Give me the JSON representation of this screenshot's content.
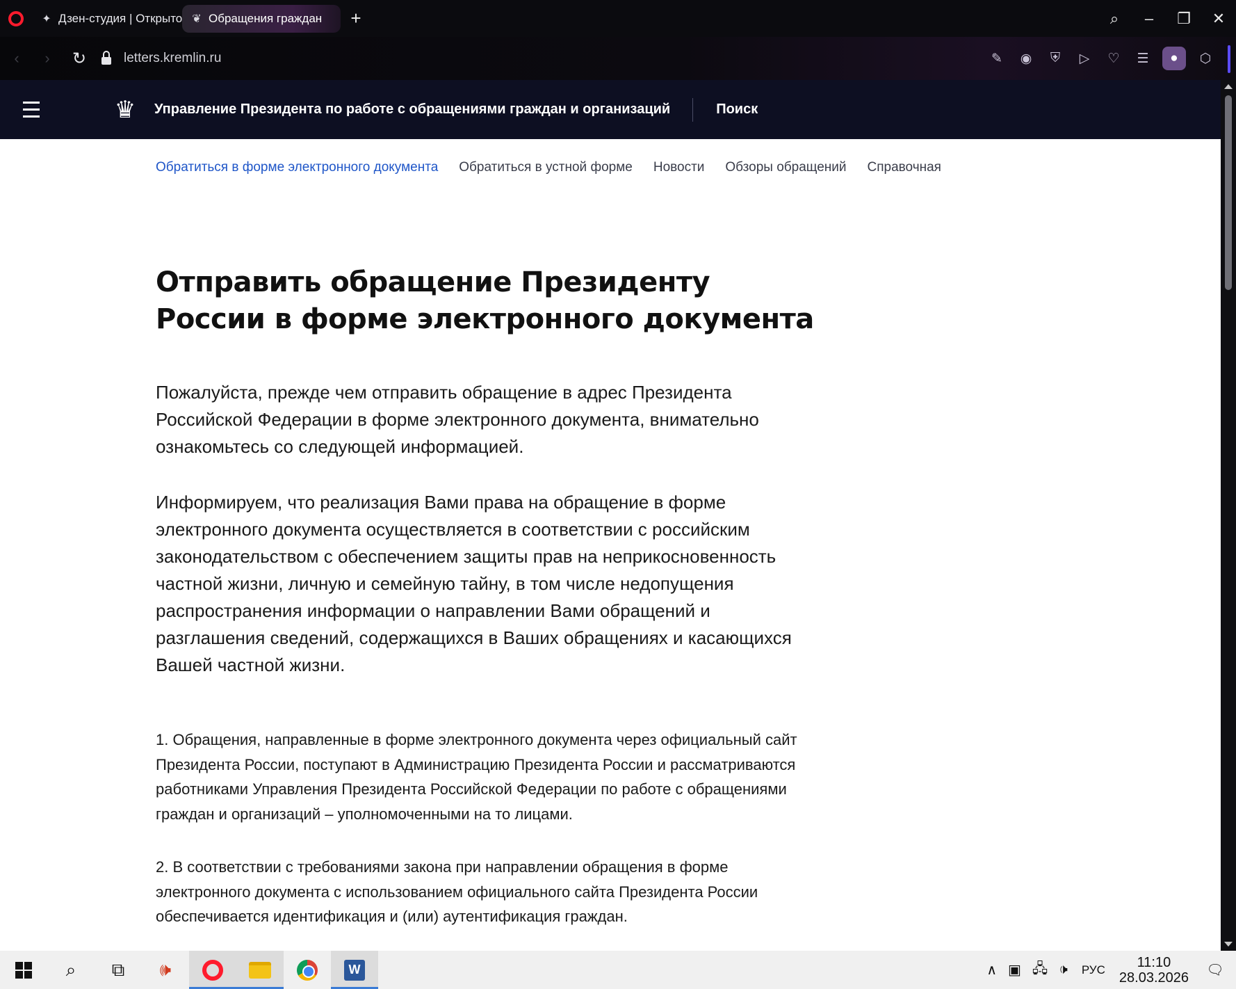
{
  "browser": {
    "tabs": [
      {
        "label": "Дзен-студия | Открытое",
        "active": false,
        "icon": "sparkle-icon"
      },
      {
        "label": "Обращения граждан",
        "active": true,
        "icon": "emblem-icon"
      }
    ],
    "new_tab": "+",
    "url": "letters.kremlin.ru"
  },
  "site": {
    "title": "Управление Президента по работе с обращениями граждан и организаций",
    "search": "Поиск",
    "subnav": [
      "Обратиться в форме электронного документа",
      "Обратиться в устной форме",
      "Новости",
      "Обзоры обращений",
      "Справочная"
    ],
    "accent_color": "#1f56c8",
    "header_color": "#0d0f22"
  },
  "page": {
    "title": "Отправить обращение Президенту России в форме электронного документа",
    "lead1": "Пожалуйста, прежде чем отправить обращение в адрес Президента Российской Федерации в форме электронного документа, внимательно ознакомьтесь со следующей информацией.",
    "lead2": "Информируем, что реализация Вами права на обращение в форме электронного документа осуществляется в соответствии с российским законодательством с обеспечением защиты прав на неприкосновенность частной жизни, личную и семейную тайну, в том числе недопущения распространения информации о направлении Вами обращений и разглашения сведений, содержащихся в Ваших обращениях и касающихся Вашей частной жизни.",
    "item1": "1. Обращения, направленные в форме электронного документа через официальный сайт Президента России, поступают в Администрацию Президента России и рассматриваются работниками Управления Президента Российской Федерации по работе с обращениями граждан и организаций – уполномоченными на то лицами.",
    "item2": "2. В соответствии с требованиями закона при направлении обращения в форме электронного документа с использованием официального сайта Президента России обеспечивается идентификация и (или) аутентификация граждан."
  },
  "taskbar": {
    "lang": "РУС",
    "time": "11:10",
    "date": "28.03.2026"
  }
}
